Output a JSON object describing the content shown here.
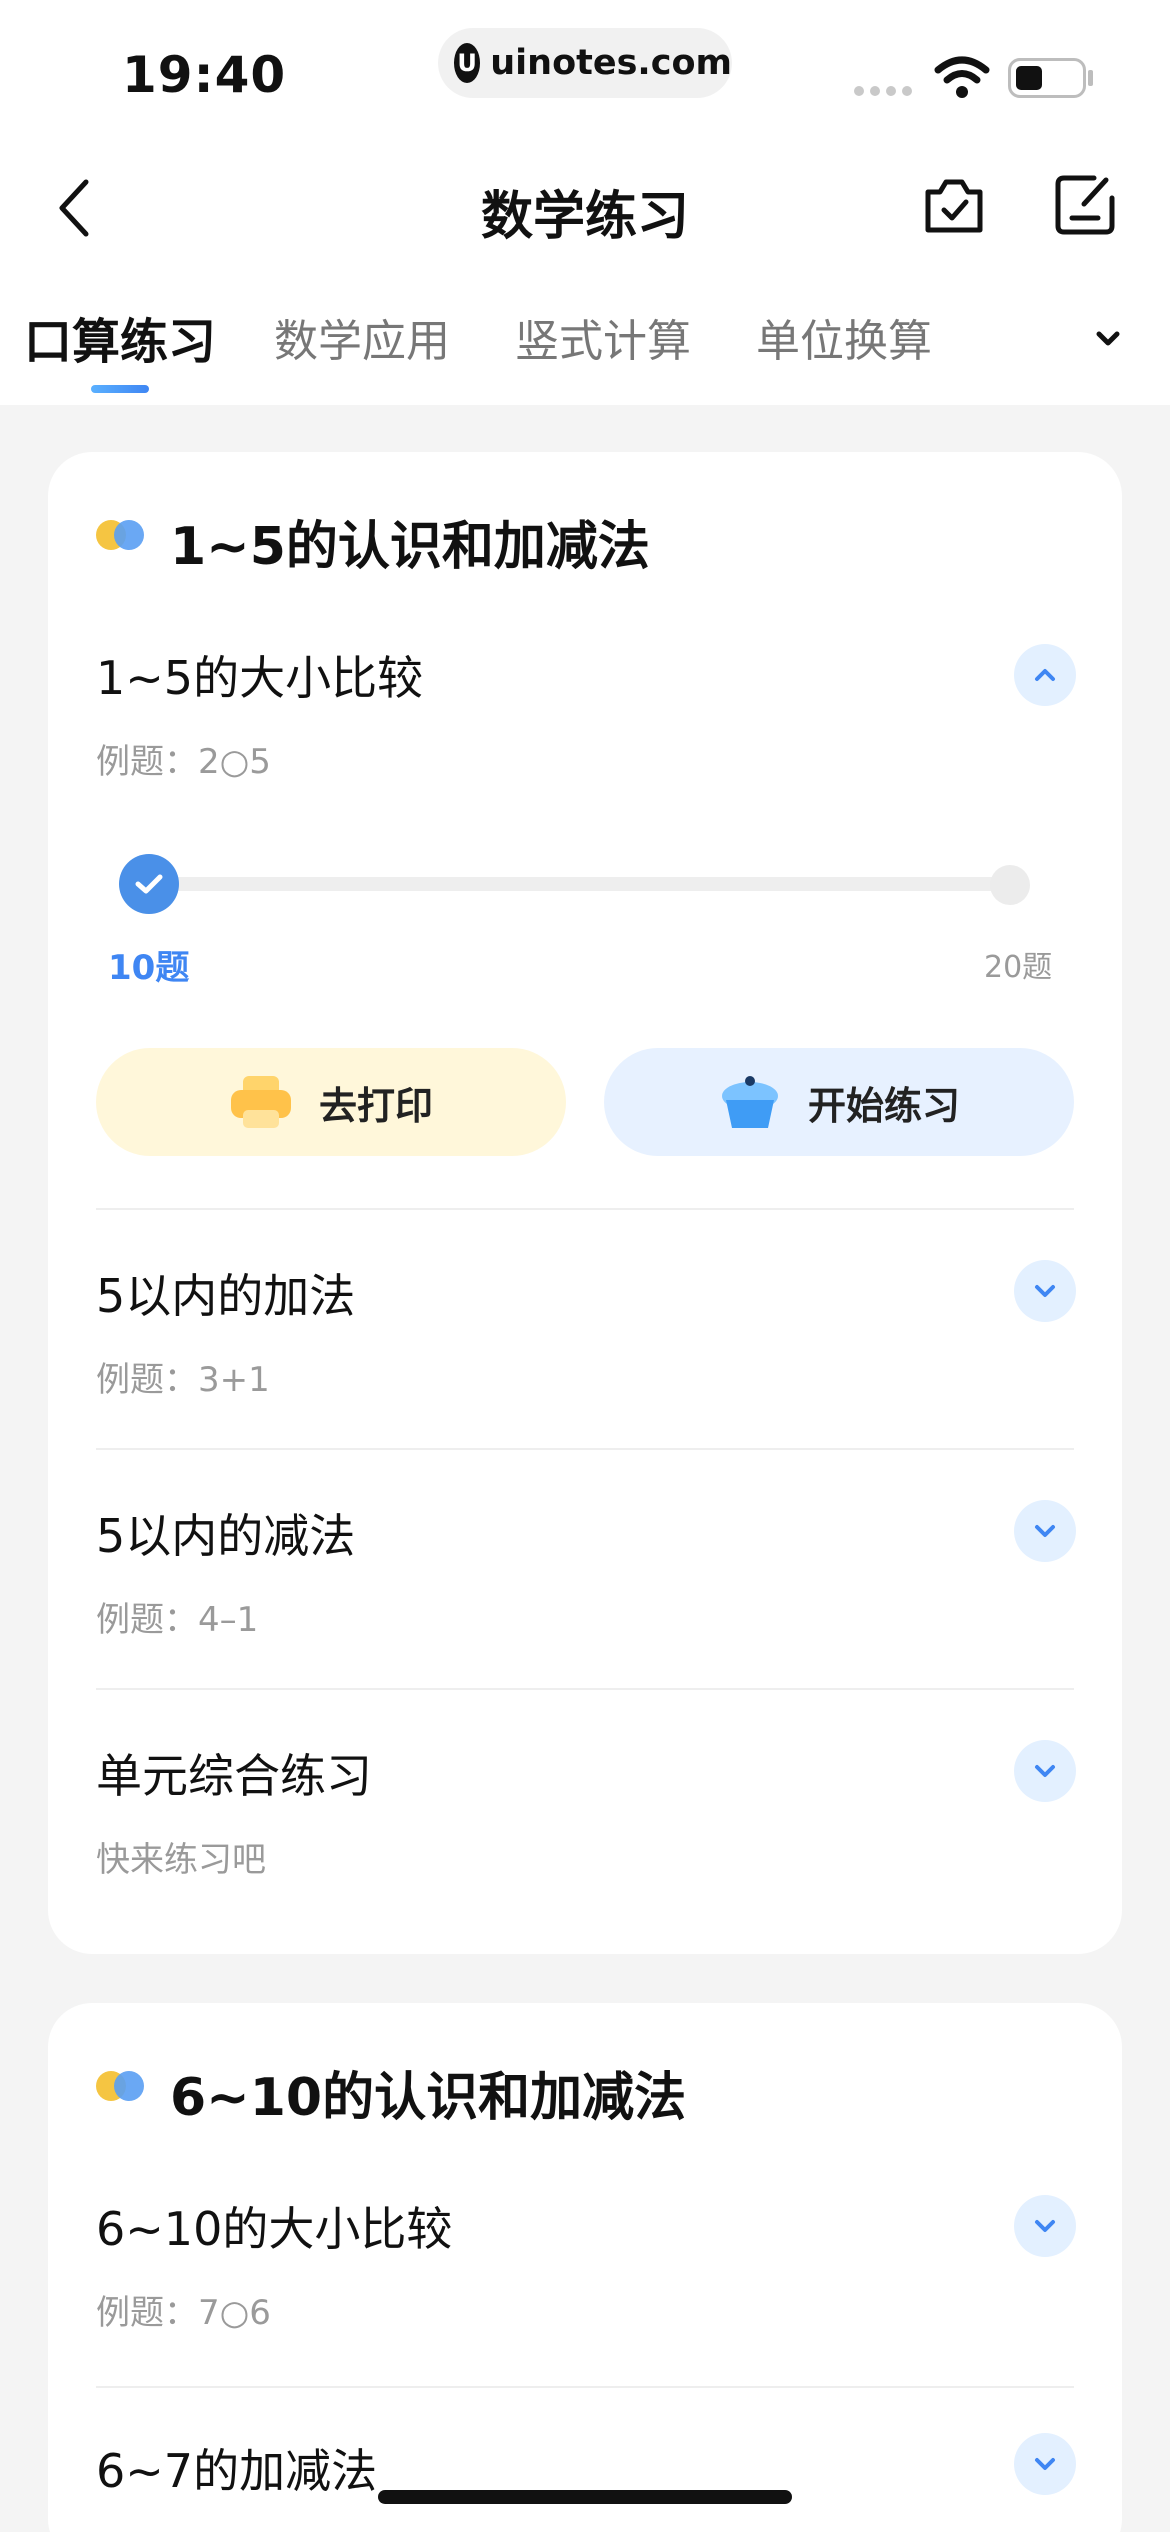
{
  "status_bar": {
    "time": "19:40",
    "url": "uinotes.com",
    "url_logo": "U"
  },
  "nav": {
    "title": "数学练习"
  },
  "tabs": [
    {
      "label": "口算练习",
      "active": true
    },
    {
      "label": "数学应用",
      "active": false
    },
    {
      "label": "竖式计算",
      "active": false
    },
    {
      "label": "单位换算",
      "active": false
    }
  ],
  "sections": [
    {
      "title": "1~5的认识和加减法",
      "expanded_item": {
        "title": "1~5的大小比较",
        "subtitle": "例题：2○5",
        "slider": {
          "min_label": "10题",
          "max_label": "20题",
          "selected": "10题"
        },
        "print_button": "去打印",
        "start_button": "开始练习"
      },
      "items": [
        {
          "title": "5以内的加法",
          "subtitle": "例题：3+1"
        },
        {
          "title": "5以内的减法",
          "subtitle": "例题：4–1"
        },
        {
          "title": "单元综合练习",
          "subtitle": "快来练习吧"
        }
      ]
    },
    {
      "title": "6~10的认识和加减法",
      "items": [
        {
          "title": "6~10的大小比较",
          "subtitle": "例题：7○6"
        },
        {
          "title": "6~7的加减法",
          "subtitle": ""
        }
      ]
    }
  ],
  "colors": {
    "accent": "#3f86f3",
    "toggle_bg": "#e3f0ff",
    "print_bg": "#fff7da",
    "start_bg": "#e7f1ff",
    "dot_yellow": "#f5c542",
    "dot_blue": "#5a9ff3"
  },
  "icons": {
    "back": "chevron-left-icon",
    "camera": "camera-check-icon",
    "edit": "edit-note-icon",
    "more": "chevron-down-icon",
    "print": "printer-icon",
    "start": "cupcake-icon"
  }
}
